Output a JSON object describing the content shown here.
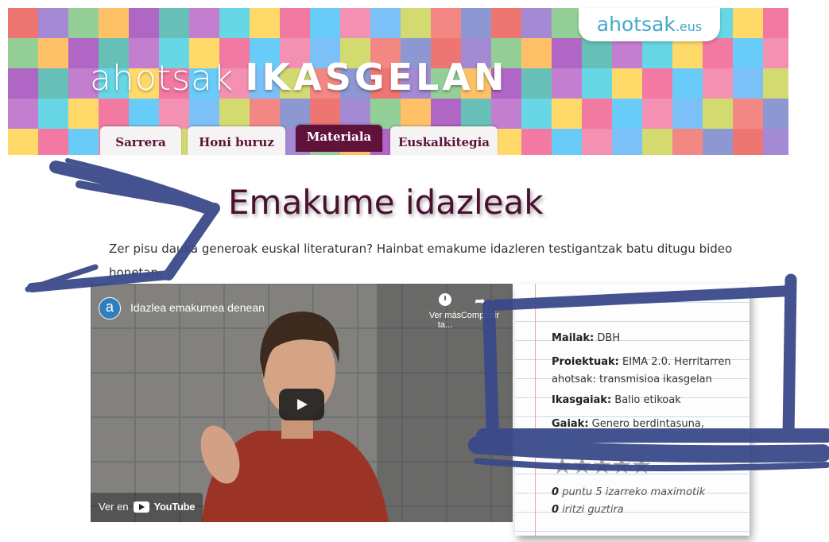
{
  "header": {
    "logo_main": "ahotsak",
    "logo_strong": "IKASGELAN",
    "site_badge": "ahotsak",
    "site_badge_tld": ".eus",
    "tabs": [
      {
        "label": "Sarrera",
        "active": false
      },
      {
        "label": "Honi buruz",
        "active": false
      },
      {
        "label": "Materiala",
        "active": true
      },
      {
        "label": "Euskalkitegia",
        "active": false
      }
    ]
  },
  "page": {
    "title": "Emakume idazleak",
    "intro_line1": "Zer pisu dauka generoak euskal literaturan? Hainbat emakume idazleren testigantzak batu ditugu bideo",
    "intro_line2": "honetan."
  },
  "video": {
    "title": "Idazlea emakumea denean",
    "channel_initial": "a",
    "watch_later": "Ver más ta...",
    "share": "Compartir",
    "watch_on": "Ver en",
    "youtube": "YouTube"
  },
  "info_card": {
    "mailak_label": "Mailak:",
    "mailak_value": "DBH",
    "proiektuak_label": "Proiektuak:",
    "proiektuak_value_1": "EIMA 2.0. Herritarren",
    "proiektuak_value_2": "ahotsak: transmisioa ikasgelan",
    "ikasgaiak_label": "Ikasgaiak:",
    "ikasgaiak_value": "Balio etikoak",
    "gaiak_label": "Gaiak:",
    "gaiak_value": "Genero berdintasuna,",
    "rating_score": "0",
    "rating_score_text": "puntu 5 izarreko maximotik",
    "rating_count": "0",
    "rating_count_text": "iritzi guztira",
    "stars_filled": 0,
    "stars_max": 5
  },
  "colors": {
    "brand": "#61123a",
    "annotation": "#3a4a8a",
    "badge_text": "#44a8cc"
  }
}
